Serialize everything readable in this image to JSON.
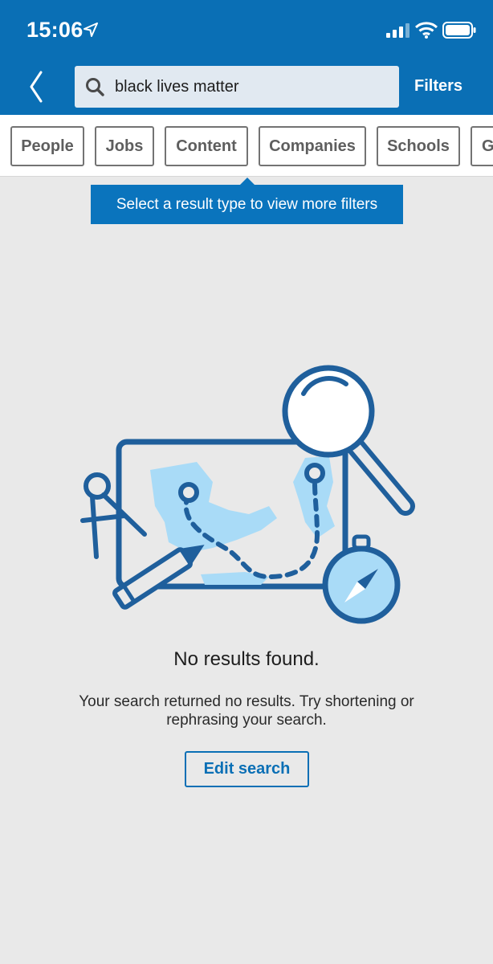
{
  "status_bar": {
    "time": "15:06",
    "icons": [
      "location-arrow-icon",
      "signal-bars-icon",
      "wifi-icon",
      "battery-icon"
    ]
  },
  "header": {
    "back_icon": "chevron-left-icon",
    "search": {
      "value": "black lives matter",
      "icon": "search-icon"
    },
    "filters_label": "Filters"
  },
  "tabs": [
    {
      "label": "People"
    },
    {
      "label": "Jobs"
    },
    {
      "label": "Content"
    },
    {
      "label": "Companies"
    },
    {
      "label": "Schools"
    },
    {
      "label": "G"
    }
  ],
  "tooltip": {
    "text": "Select a result type to view more filters"
  },
  "empty_state": {
    "illustration": "map-search-illustration",
    "title": "No results found.",
    "message": "Your search returned no results. Try shortening or rephrasing your search.",
    "edit_button": "Edit search"
  },
  "colors": {
    "brand_blue": "#0a6fb5",
    "tooltip_blue": "#0a74bd",
    "background": "#e9e9e9",
    "illustration_dark": "#1f5f9c",
    "illustration_light": "#a9dbf7"
  }
}
